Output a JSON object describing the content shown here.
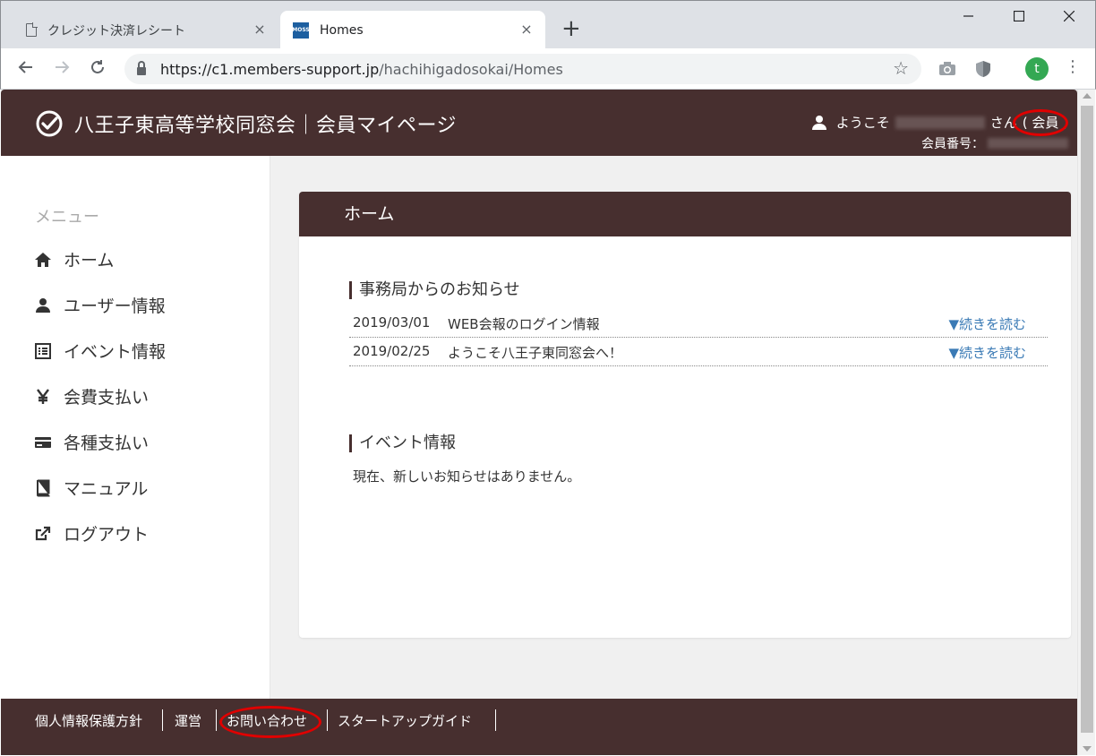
{
  "browser": {
    "tabs": [
      {
        "title": "クレジット決済レシート",
        "active": false
      },
      {
        "title": "Homes",
        "active": true
      }
    ],
    "url_host": "https://c1.members-support.jp",
    "url_path": "/hachihigadosokai/Homes",
    "profile_initial": "t",
    "favicon_text": "MOSS",
    "new_tab": "+",
    "close_glyph": "×"
  },
  "header": {
    "site_title": "八王子東高等学校同窓会｜会員マイページ",
    "welcome_prefix": "ようこそ",
    "welcome_suffix": "さん",
    "member_type": "( 会員 )",
    "member_no_label": "会員番号："
  },
  "sidebar": {
    "heading": "メニュー",
    "items": [
      {
        "label": "ホーム",
        "icon": "home-icon"
      },
      {
        "label": "ユーザー情報",
        "icon": "user-icon"
      },
      {
        "label": "イベント情報",
        "icon": "list-icon"
      },
      {
        "label": "会費支払い",
        "icon": "yen-icon"
      },
      {
        "label": "各種支払い",
        "icon": "card-icon"
      },
      {
        "label": "マニュアル",
        "icon": "book-icon"
      },
      {
        "label": "ログアウト",
        "icon": "logout-icon"
      }
    ]
  },
  "main": {
    "card_title": "ホーム",
    "news_title": "事務局からのお知らせ",
    "news": [
      {
        "date": "2019/03/01",
        "title": "WEB会報のログイン情報",
        "more": "▼続きを読む"
      },
      {
        "date": "2019/02/25",
        "title": "ようこそ八王子東同窓会へ！",
        "more": "▼続きを読む"
      }
    ],
    "events_title": "イベント情報",
    "events_empty": "現在、新しいお知らせはありません。"
  },
  "footer": {
    "links": [
      "個人情報保護方針",
      "運営",
      "お問い合わせ",
      "スタートアップガイド"
    ]
  },
  "colors": {
    "brand": "#472f2f",
    "link": "#3a7ab5",
    "annotation": "#e00000"
  }
}
